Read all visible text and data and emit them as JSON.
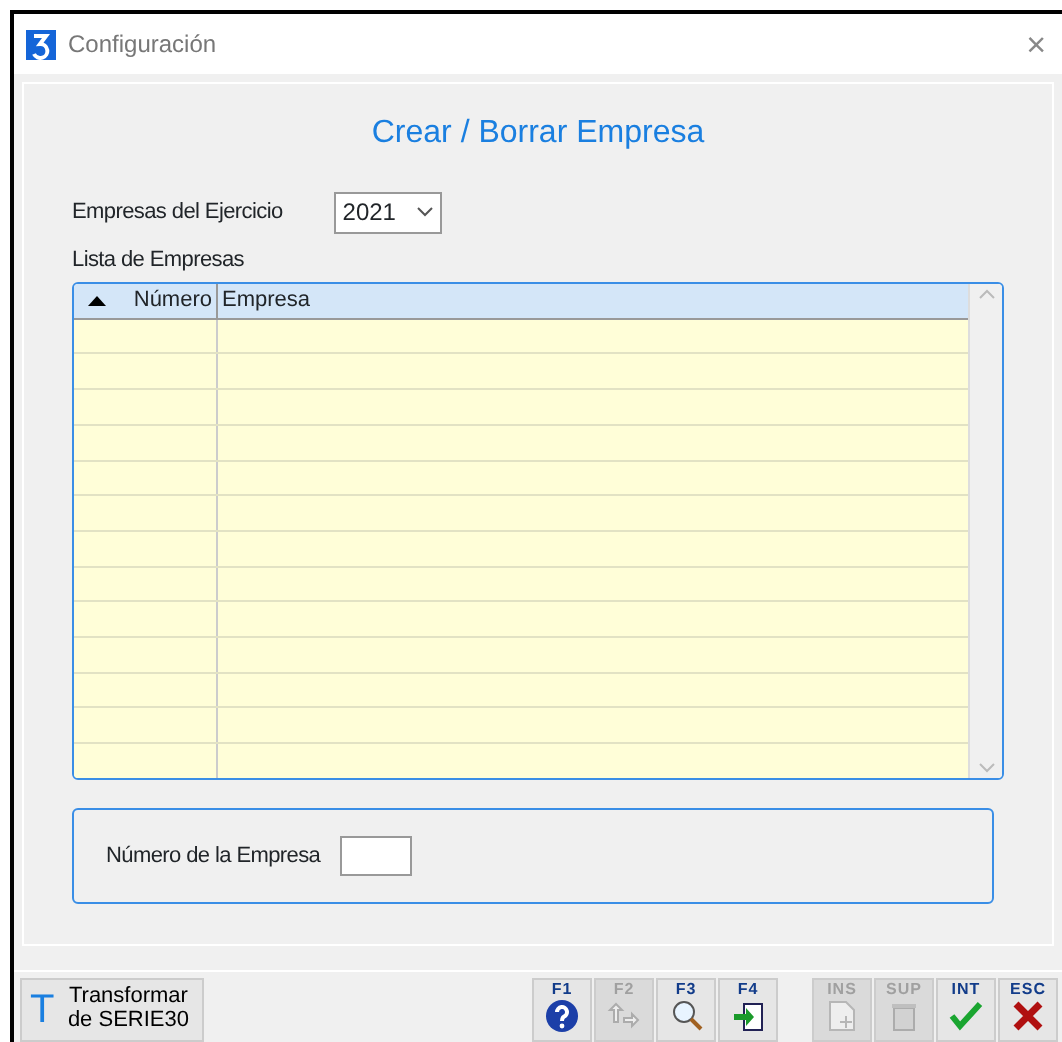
{
  "window": {
    "title": "Configuración",
    "close": "×"
  },
  "heading": "Crear / Borrar Empresa",
  "year_field": {
    "label": "Empresas del Ejercicio",
    "value": "2021"
  },
  "list": {
    "label": "Lista de Empresas",
    "columns": [
      {
        "label": "Número",
        "sorted": true
      },
      {
        "label": "Empresa"
      }
    ]
  },
  "number_field": {
    "label": "Número de la Empresa"
  },
  "transform_button": {
    "icon": "T",
    "label": "Transformar de SERIE30"
  },
  "function_keys": [
    {
      "key": "F1",
      "kind": "help",
      "disabled": false
    },
    {
      "key": "F2",
      "kind": "move",
      "disabled": true
    },
    {
      "key": "F3",
      "kind": "search",
      "disabled": false
    },
    {
      "key": "F4",
      "kind": "enter",
      "disabled": false
    },
    {
      "key": "INS",
      "kind": "new",
      "disabled": true
    },
    {
      "key": "SUP",
      "kind": "delete",
      "disabled": true
    },
    {
      "key": "INT",
      "kind": "accept",
      "disabled": false
    },
    {
      "key": "ESC",
      "kind": "cancel",
      "disabled": false
    }
  ]
}
